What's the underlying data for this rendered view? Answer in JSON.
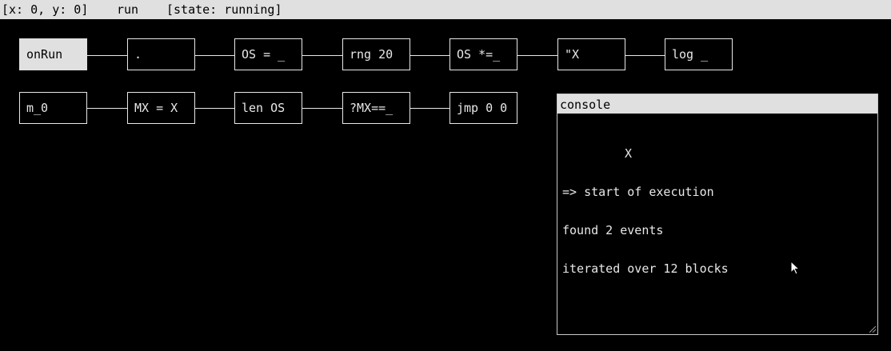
{
  "status": {
    "coords": "[x: 0, y: 0]",
    "mode": "run",
    "state": "[state: running]"
  },
  "blocks_row1": [
    "onRun",
    ".",
    "OS = _",
    "rng 20",
    "OS *=_",
    "\"X",
    "log _"
  ],
  "blocks_row2": [
    "m_0",
    "MX = X",
    "len OS",
    "?MX==_",
    "jmp 0 0"
  ],
  "active_block": "onRun",
  "console": {
    "title": "console",
    "header_line": "X",
    "lines": [
      "=> start of execution",
      "found 2 events",
      "iterated over 12 blocks"
    ]
  },
  "icons": {
    "cursor": "mouse-pointer-icon",
    "grip": "resize-grip-icon"
  },
  "colors": {
    "background": "#000000",
    "foreground": "#e8e8e8",
    "bar": "#e0e0e0"
  }
}
